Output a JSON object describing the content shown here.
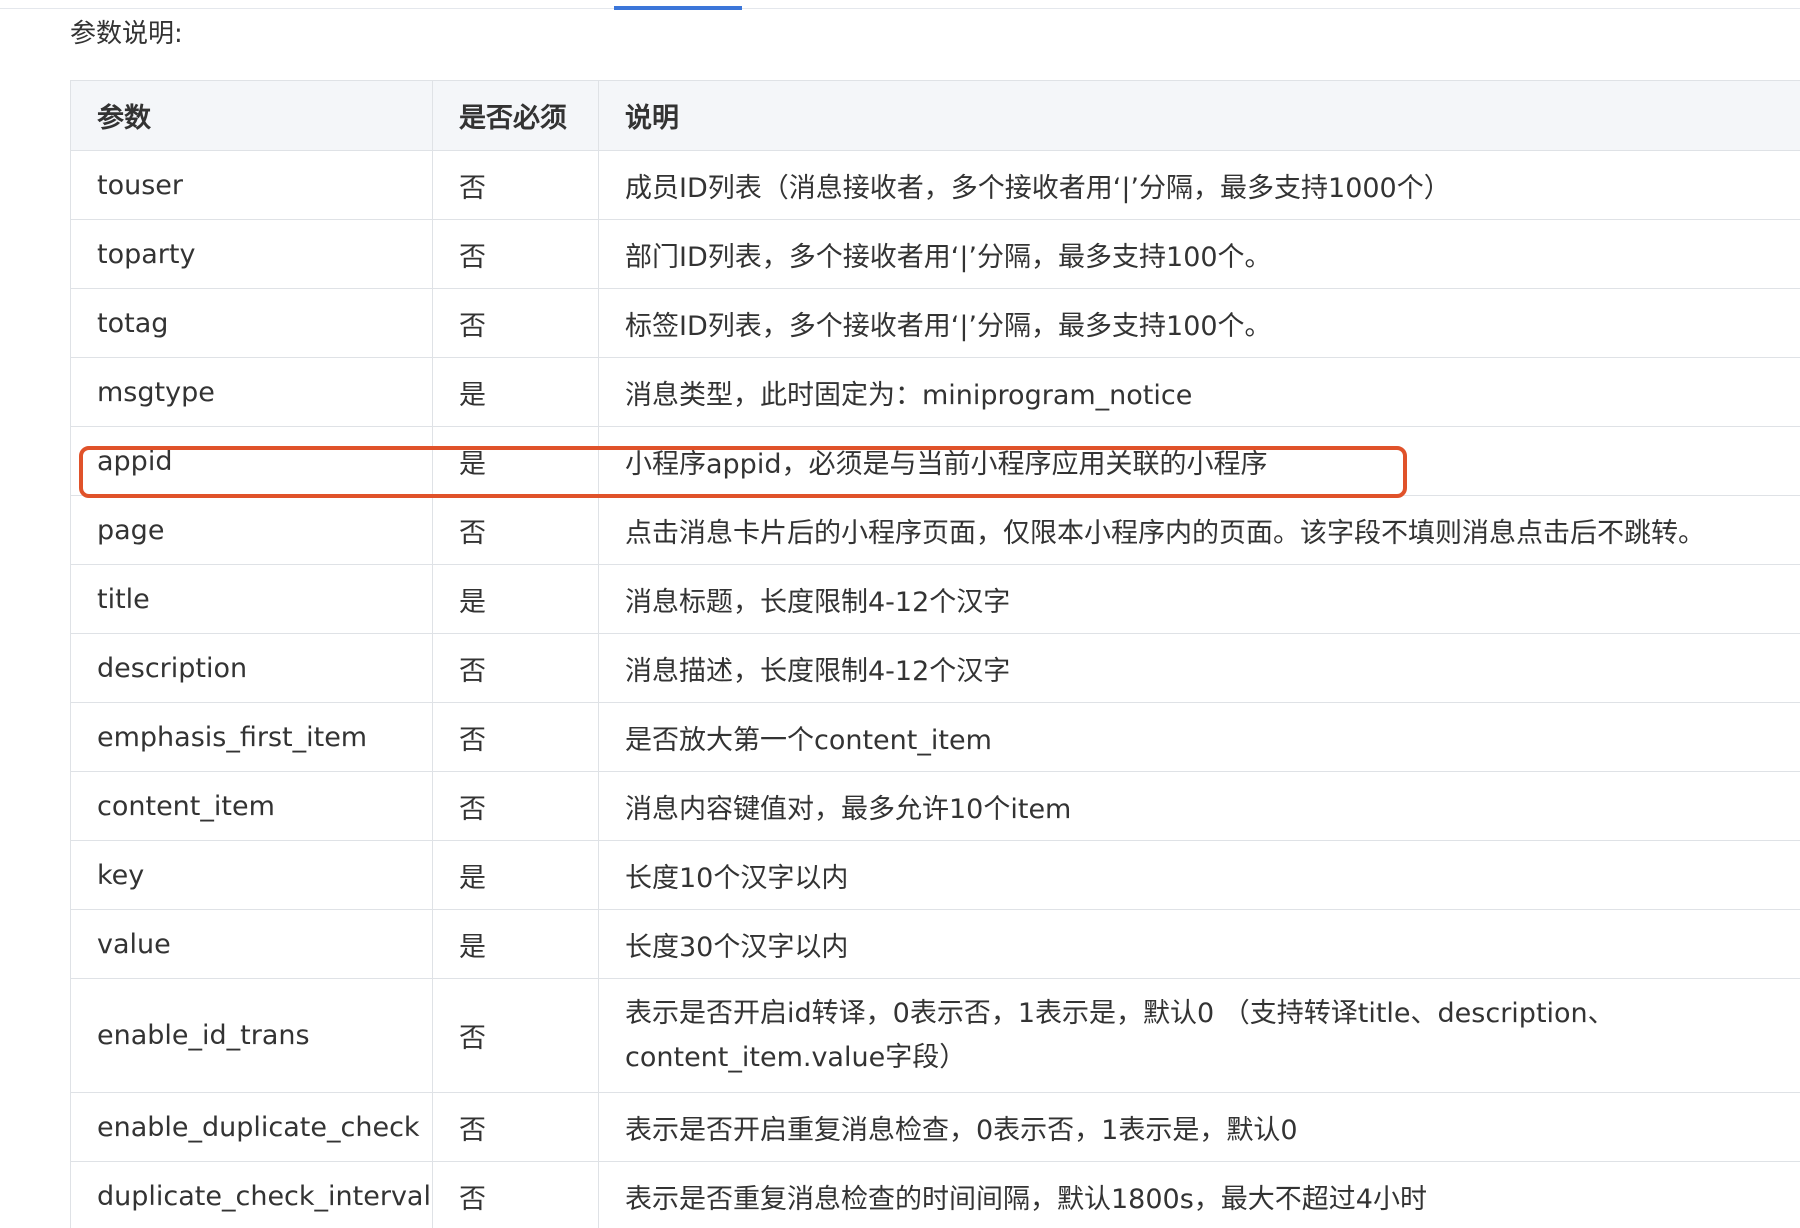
{
  "section_title": "参数说明:",
  "table": {
    "headers": [
      "参数",
      "是否必须",
      "说明"
    ],
    "rows": [
      {
        "param": "touser",
        "required": "否",
        "desc": "成员ID列表（消息接收者，多个接收者用‘|’分隔，最多支持1000个）"
      },
      {
        "param": "toparty",
        "required": "否",
        "desc": "部门ID列表，多个接收者用‘|’分隔，最多支持100个。"
      },
      {
        "param": "totag",
        "required": "否",
        "desc": "标签ID列表，多个接收者用‘|’分隔，最多支持100个。"
      },
      {
        "param": "msgtype",
        "required": "是",
        "desc": "消息类型，此时固定为：miniprogram_notice"
      },
      {
        "param": "appid",
        "required": "是",
        "desc": "小程序appid，必须是与当前小程序应用关联的小程序"
      },
      {
        "param": "page",
        "required": "否",
        "desc": "点击消息卡片后的小程序页面，仅限本小程序内的页面。该字段不填则消息点击后不跳转。"
      },
      {
        "param": "title",
        "required": "是",
        "desc": "消息标题，长度限制4-12个汉字"
      },
      {
        "param": "description",
        "required": "否",
        "desc": "消息描述，长度限制4-12个汉字"
      },
      {
        "param": "emphasis_first_item",
        "required": "否",
        "desc": "是否放大第一个content_item"
      },
      {
        "param": "content_item",
        "required": "否",
        "desc": "消息内容键值对，最多允许10个item"
      },
      {
        "param": "key",
        "required": "是",
        "desc": "长度10个汉字以内"
      },
      {
        "param": "value",
        "required": "是",
        "desc": "长度30个汉字以内"
      },
      {
        "param": "enable_id_trans",
        "required": "否",
        "desc": "表示是否开启id转译，0表示否，1表示是，默认0 （支持转译title、description、content_item.value字段）"
      },
      {
        "param": "enable_duplicate_check",
        "required": "否",
        "desc": "表示是否开启重复消息检查，0表示否，1表示是，默认0"
      },
      {
        "param": "duplicate_check_interval",
        "required": "否",
        "desc": "表示是否重复消息检查的时间间隔，默认1800s，最大不超过4小时"
      }
    ]
  },
  "highlight": {
    "row": "appid",
    "color": "#e0522a"
  },
  "colors": {
    "header_bg": "#f4f6f9",
    "border": "#dfe2e6",
    "tab_indicator": "#3b76d9"
  }
}
